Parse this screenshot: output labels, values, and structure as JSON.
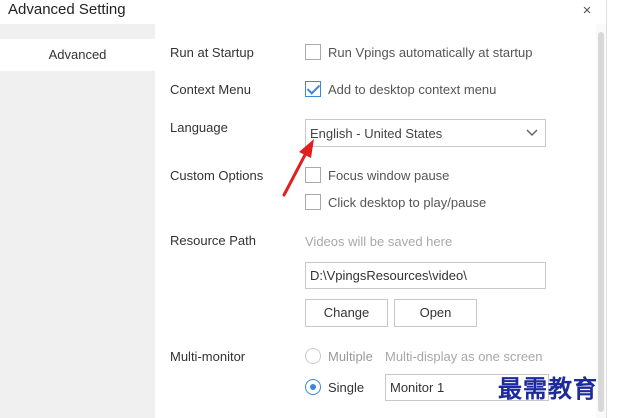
{
  "window": {
    "title": "Advanced Setting",
    "close_glyph": "×"
  },
  "sidebar": {
    "items": [
      {
        "label": "Advanced"
      }
    ]
  },
  "settings": {
    "startup": {
      "label": "Run at Startup",
      "option": "Run Vpings automatically at startup",
      "checked": false
    },
    "context_menu": {
      "label": "Context Menu",
      "option": "Add to desktop context menu",
      "checked": true
    },
    "language": {
      "label": "Language",
      "value": "English - United States"
    },
    "custom_options": {
      "label": "Custom Options",
      "options": [
        {
          "label": "Focus window pause",
          "checked": false
        },
        {
          "label": "Click desktop to play/pause",
          "checked": false
        }
      ]
    },
    "resource_path": {
      "label": "Resource Path",
      "hint": "Videos will be saved here",
      "value": "D:\\VpingsResources\\video\\",
      "change_label": "Change",
      "open_label": "Open"
    },
    "multi_monitor": {
      "label": "Multi-monitor",
      "multiple_label": "Multiple",
      "multiple_desc": "Multi-display as one screen",
      "single_label": "Single",
      "selected": "Single",
      "monitor_value": "Monitor 1"
    }
  },
  "watermark": {
    "text": "最需教育"
  },
  "colors": {
    "accent": "#3d87d8",
    "annotation_arrow": "#e02020",
    "watermark": "#1d2a9c"
  }
}
